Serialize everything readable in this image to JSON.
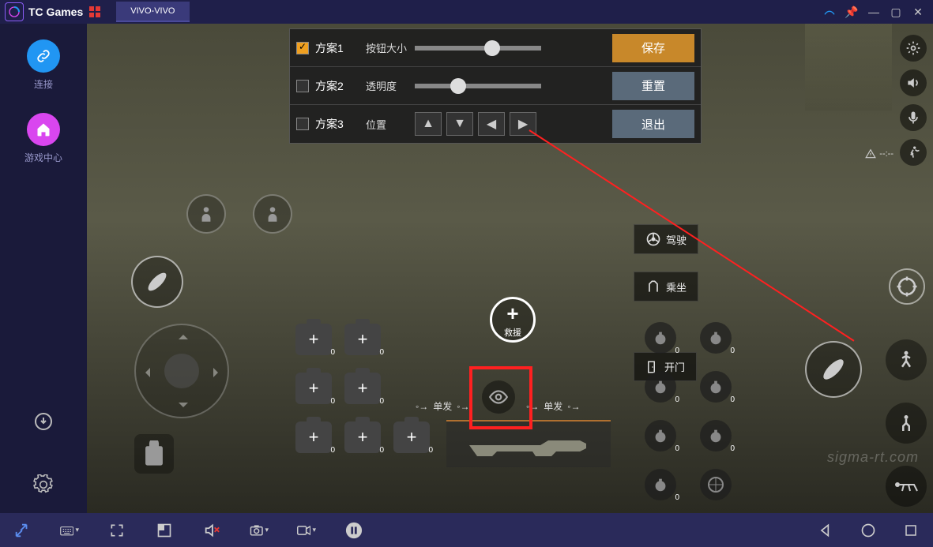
{
  "titlebar": {
    "app_name": "TC Games",
    "tab_label": "VIVO-VIVO"
  },
  "sidebar": {
    "connect_label": "连接",
    "gamecenter_label": "游戏中心"
  },
  "panel": {
    "plan1": "方案1",
    "plan2": "方案2",
    "plan3": "方案3",
    "btn_size": "按钮大小",
    "opacity": "透明度",
    "position": "位置",
    "save": "保存",
    "reset": "重置",
    "exit": "退出",
    "slider_size_pct": 55,
    "slider_opacity_pct": 28
  },
  "hud": {
    "rescue": "救援",
    "drive": "驾驶",
    "ride": "乘坐",
    "open_door": "开门",
    "fire_mode": "单发",
    "ping": "--:--",
    "kit_count": "0",
    "grenade_count": "0"
  },
  "watermark": "sigma-rt.com"
}
